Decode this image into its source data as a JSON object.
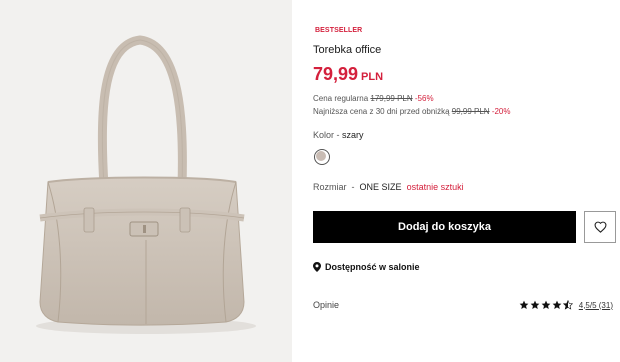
{
  "product": {
    "badge": "BESTSELLER",
    "name": "Torebka office",
    "price": "79,99",
    "currency": "PLN",
    "regular_price_label": "Cena regularna",
    "regular_price": "179,99 PLN",
    "regular_discount": "-56%",
    "lowest_price_label": "Najniższa cena z 30 dni przed obniżką",
    "lowest_price": "99,99 PLN",
    "lowest_discount": "-20%"
  },
  "color": {
    "label": "Kolor",
    "separator": "-",
    "value": "szary",
    "swatch": "#c9bcb4"
  },
  "size": {
    "label": "Rozmiar",
    "separator": "-",
    "value": "ONE SIZE",
    "stock_note": "ostatnie sztuki"
  },
  "actions": {
    "add_to_cart": "Dodaj do koszyka",
    "store_availability": "Dostępność w salonie"
  },
  "reviews": {
    "label": "Opinie",
    "rating_text": "4,5/5 (31)",
    "stars": 4.5
  },
  "colors": {
    "accent_red": "#d4203c",
    "button_black": "#000000",
    "image_bg": "#f2f1ef"
  },
  "icons": [
    "heart-icon",
    "location-pin-icon",
    "star-icon"
  ]
}
